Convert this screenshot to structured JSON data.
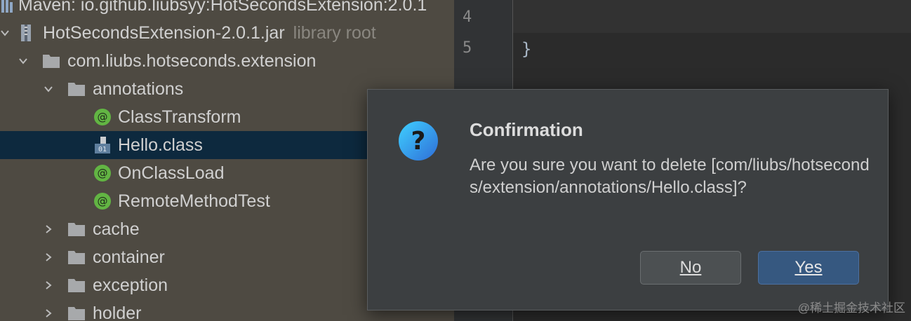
{
  "tree": {
    "header": "Maven: io.github.liubsyy:HotSecondsExtension:2.0.1",
    "jar": {
      "name": "HotSecondsExtension-2.0.1.jar",
      "hint": "library root"
    },
    "package": "com.liubs.hotseconds.extension",
    "annotations_folder": "annotations",
    "annotation_items": [
      "ClassTransform",
      "Hello.class",
      "OnClassLoad",
      "RemoteMethodTest"
    ],
    "folders": [
      "cache",
      "container",
      "exception",
      "holder"
    ],
    "selected": "Hello.class"
  },
  "editor": {
    "line_numbers": [
      "4",
      "5"
    ],
    "lines": [
      "",
      "}"
    ]
  },
  "dialog": {
    "title": "Confirmation",
    "message": "Are you sure you want to delete [com/liubs/hotseconds/extension/annotations/Hello.class]?",
    "no_label": "No",
    "yes_label": "Yes",
    "icon": "question-icon"
  },
  "watermark": "@稀土掘金技术社区",
  "colors": {
    "tree_bg": "#4e4a42",
    "selection": "#0d293e",
    "dialog_bg": "#3c3f41",
    "yes_button": "#365880",
    "annotation_icon": "#62b543"
  }
}
